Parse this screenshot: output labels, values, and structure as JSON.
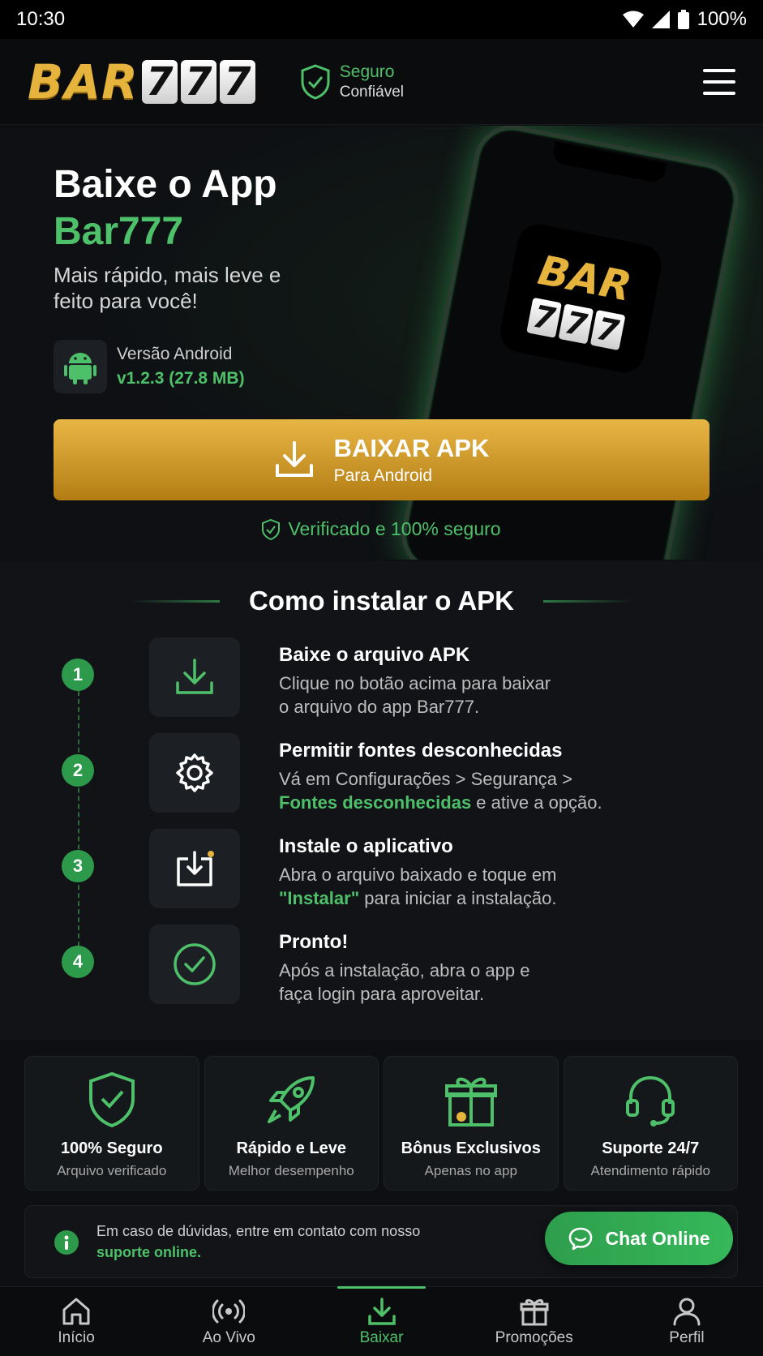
{
  "status_bar": {
    "time": "10:30",
    "battery": "100%"
  },
  "header": {
    "logo_text": "BAR",
    "logo_digits": [
      "7",
      "7",
      "7"
    ],
    "secure_line1": "Seguro",
    "secure_line2": "Confiável"
  },
  "hero": {
    "title": "Baixe o App",
    "title_highlight": "Bar777",
    "subtitle": "Mais rápido, mais leve e feito para você!",
    "version_label": "Versão Android",
    "version_value": "v1.2.3 (27.8 MB)",
    "phone_logo_text": "BAR",
    "phone_logo_digits": [
      "7",
      "7",
      "7"
    ],
    "download_button": {
      "title": "BAIXAR APK",
      "subtitle": "Para Android"
    },
    "verified_text": "Verificado e 100% seguro"
  },
  "install": {
    "heading": "Como instalar o APK",
    "steps": [
      {
        "number": "1",
        "title": "Baixe o arquivo APK",
        "desc_a": "Clique no botão acima para baixar",
        "desc_b": "o arquivo do app Bar777.",
        "icon": "download-icon"
      },
      {
        "number": "2",
        "title": "Permitir fontes desconhecidas",
        "desc_a": "Vá em Configurações > Segurança >",
        "desc_b_highlight": "Fontes desconhecidas",
        "desc_b_rest": " e ative a opção.",
        "icon": "gear-icon"
      },
      {
        "number": "3",
        "title": "Instale o aplicativo",
        "desc_a": "Abra o arquivo baixado e toque em",
        "desc_b_highlight": "\"Instalar\"",
        "desc_b_rest": " para iniciar a instalação.",
        "icon": "install-icon"
      },
      {
        "number": "4",
        "title": "Pronto!",
        "desc_a": "Após a instalação, abra o app e",
        "desc_b": "faça login para aproveitar.",
        "icon": "check-circle-icon"
      }
    ]
  },
  "features": [
    {
      "title": "100% Seguro",
      "desc": "Arquivo verificado",
      "icon": "shield-check-icon"
    },
    {
      "title": "Rápido e Leve",
      "desc": "Melhor desempenho",
      "icon": "rocket-icon"
    },
    {
      "title": "Bônus Exclusivos",
      "desc": "Apenas no app",
      "icon": "gift-icon"
    },
    {
      "title": "Suporte 24/7",
      "desc": "Atendimento rápido",
      "icon": "headset-icon"
    }
  ],
  "help": {
    "text": "Em caso de dúvidas, entre em contato com nosso",
    "link": "suporte online."
  },
  "chat_button": "Chat Online",
  "bottom_nav": [
    {
      "label": "Início",
      "icon": "home-icon"
    },
    {
      "label": "Ao Vivo",
      "icon": "live-icon"
    },
    {
      "label": "Baixar",
      "icon": "download-icon",
      "active": true
    },
    {
      "label": "Promoções",
      "icon": "gift-icon"
    },
    {
      "label": "Perfil",
      "icon": "user-icon"
    }
  ],
  "colors": {
    "accent_green": "#4fc06a",
    "gold": "#e6b43c",
    "background": "#0d0f12"
  }
}
